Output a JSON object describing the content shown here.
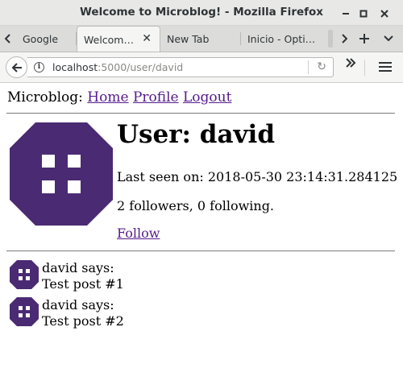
{
  "window": {
    "title": "Welcome to Microblog! - Mozilla Firefox"
  },
  "tabs": [
    {
      "label": "Google",
      "active": false
    },
    {
      "label": "Welcom…",
      "active": true
    },
    {
      "label": "New Tab",
      "active": false
    },
    {
      "label": "Inicio - Opti…",
      "active": false
    }
  ],
  "url": {
    "host": "localhost",
    "path": ":5000/user/david"
  },
  "colors": {
    "avatar": "#4a2a73",
    "link": "#551a8b"
  },
  "page": {
    "brand": "Microblog:",
    "nav": {
      "home": "Home",
      "profile": "Profile",
      "logout": "Logout"
    },
    "user": {
      "heading": "User: david",
      "last_seen": "Last seen on: 2018-05-30 23:14:31.284125",
      "follow_counts": "2 followers, 0 following.",
      "follow_link": "Follow"
    },
    "posts": [
      {
        "author_line": "david says:",
        "body": "Test post #1"
      },
      {
        "author_line": "david says:",
        "body": "Test post #2"
      }
    ]
  }
}
